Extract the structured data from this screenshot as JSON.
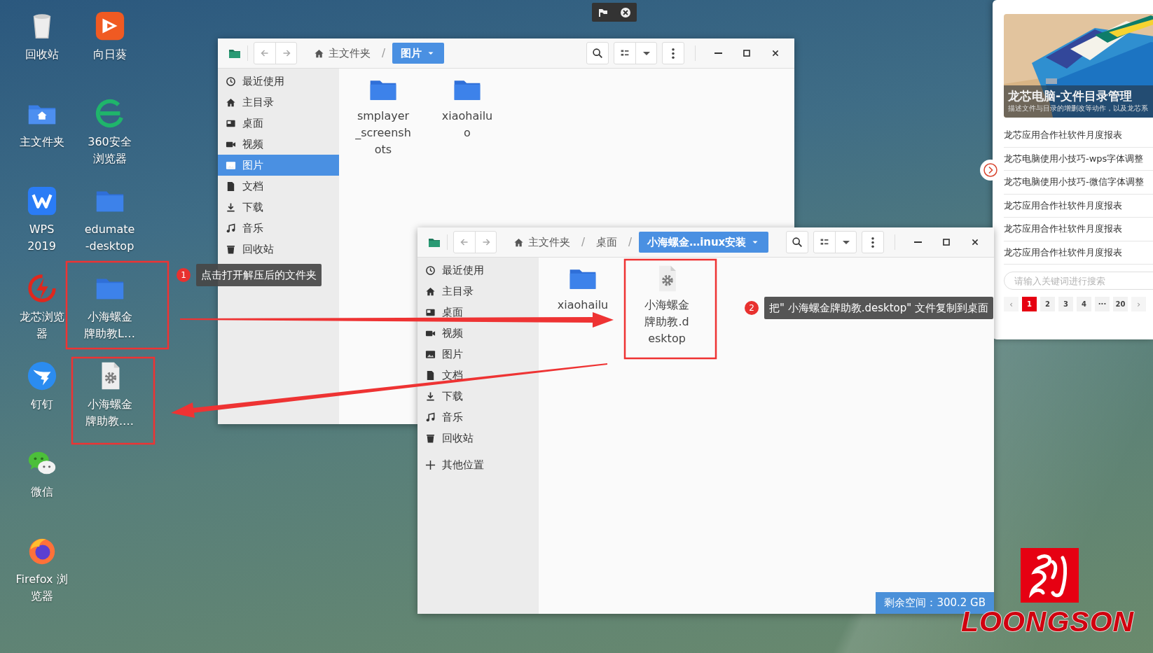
{
  "desktop_icons": [
    {
      "label": "回收站",
      "kind": "trash"
    },
    {
      "label": "主文件夹",
      "kind": "home-folder"
    },
    {
      "label": "WPS 2019",
      "kind": "wps"
    },
    {
      "label": "龙芯浏览器",
      "kind": "loongson-browser"
    },
    {
      "label": "钉钉",
      "kind": "dingtalk"
    },
    {
      "label": "微信",
      "kind": "wechat"
    },
    {
      "label": "Firefox 浏览器",
      "kind": "firefox"
    },
    {
      "label": "向日葵",
      "kind": "sunlogin"
    },
    {
      "label": "360安全浏览器",
      "kind": "browser-360"
    },
    {
      "label": "edumate-desktop",
      "kind": "folder"
    },
    {
      "label": "小海螺金牌助教L…",
      "kind": "folder"
    },
    {
      "label": "小海螺金牌助教.…",
      "kind": "settings-file"
    }
  ],
  "windows": [
    {
      "breadcrumbs": [
        {
          "label": "主文件夹",
          "kind": "home",
          "selected": false
        },
        {
          "label": "/",
          "kind": "separator"
        },
        {
          "label": "图片",
          "kind": "folder",
          "selected": true
        }
      ],
      "sidebar": [
        {
          "label": "最近使用",
          "kind": "recent",
          "selected": false
        },
        {
          "label": "主目录",
          "kind": "home",
          "selected": false
        },
        {
          "label": "桌面",
          "kind": "desktop",
          "selected": false
        },
        {
          "label": "视频",
          "kind": "video",
          "selected": false
        },
        {
          "label": "图片",
          "kind": "pictures",
          "selected": true
        },
        {
          "label": "文档",
          "kind": "documents",
          "selected": false
        },
        {
          "label": "下载",
          "kind": "downloads",
          "selected": false
        },
        {
          "label": "音乐",
          "kind": "music",
          "selected": false
        },
        {
          "label": "回收站",
          "kind": "trash",
          "selected": false
        }
      ],
      "files": [
        {
          "name": "smplayer_screenshots",
          "kind": "folder"
        },
        {
          "name": "xiaohailuo",
          "kind": "folder"
        }
      ]
    },
    {
      "breadcrumbs": [
        {
          "label": "主文件夹",
          "kind": "home",
          "selected": false
        },
        {
          "label": "/",
          "kind": "separator"
        },
        {
          "label": "桌面",
          "kind": "folder",
          "selected": false
        },
        {
          "label": "/",
          "kind": "separator"
        },
        {
          "label": "小海螺金…inux安装",
          "kind": "folder",
          "selected": true
        }
      ],
      "sidebar": [
        {
          "label": "最近使用",
          "kind": "recent",
          "selected": false
        },
        {
          "label": "主目录",
          "kind": "home",
          "selected": false
        },
        {
          "label": "桌面",
          "kind": "desktop",
          "selected": false
        },
        {
          "label": "视频",
          "kind": "video",
          "selected": false
        },
        {
          "label": "图片",
          "kind": "pictures",
          "selected": false
        },
        {
          "label": "文档",
          "kind": "documents",
          "selected": false
        },
        {
          "label": "下载",
          "kind": "downloads",
          "selected": false
        },
        {
          "label": "音乐",
          "kind": "music",
          "selected": false
        },
        {
          "label": "回收站",
          "kind": "trash",
          "selected": false
        },
        {
          "label": "其他位置",
          "kind": "other",
          "selected": false
        }
      ],
      "files": [
        {
          "name": "xiaohailu",
          "kind": "folder"
        },
        {
          "name": "小海螺金牌助教.desktop",
          "kind": "settings-file"
        }
      ],
      "status": "剩余空间：300.2 GB"
    }
  ],
  "side_panel": {
    "banner_title": "龙芯电脑-文件目录管理",
    "banner_subtitle": "描述文件与目录的增删改等动作，以及龙芯系",
    "articles": [
      "龙芯应用合作社软件月度报表",
      "龙芯电脑使用小技巧-wps字体调整",
      "龙芯电脑使用小技巧-微信字体调整",
      "龙芯应用合作社软件月度报表",
      "龙芯应用合作社软件月度报表",
      "龙芯应用合作社软件月度报表"
    ],
    "search": {
      "placeholder": "请输入关键词进行搜索"
    },
    "pagination": [
      {
        "label": "‹",
        "kind": "prev",
        "selected": false
      },
      {
        "label": "1",
        "kind": "page",
        "selected": true
      },
      {
        "label": "2",
        "kind": "page",
        "selected": false
      },
      {
        "label": "3",
        "kind": "page",
        "selected": false
      },
      {
        "label": "4",
        "kind": "page",
        "selected": false
      },
      {
        "label": "···",
        "kind": "ellipsis",
        "selected": false
      },
      {
        "label": "20",
        "kind": "page",
        "selected": false
      },
      {
        "label": "›",
        "kind": "next",
        "selected": false
      }
    ]
  },
  "annotations": [
    {
      "number": "1",
      "text": "点击打开解压后的文件夹"
    },
    {
      "number": "2",
      "text": "把\" 小海螺金牌助教.desktop\" 文件复制到桌面"
    }
  ],
  "logo": {
    "text": "LOONGSON"
  }
}
